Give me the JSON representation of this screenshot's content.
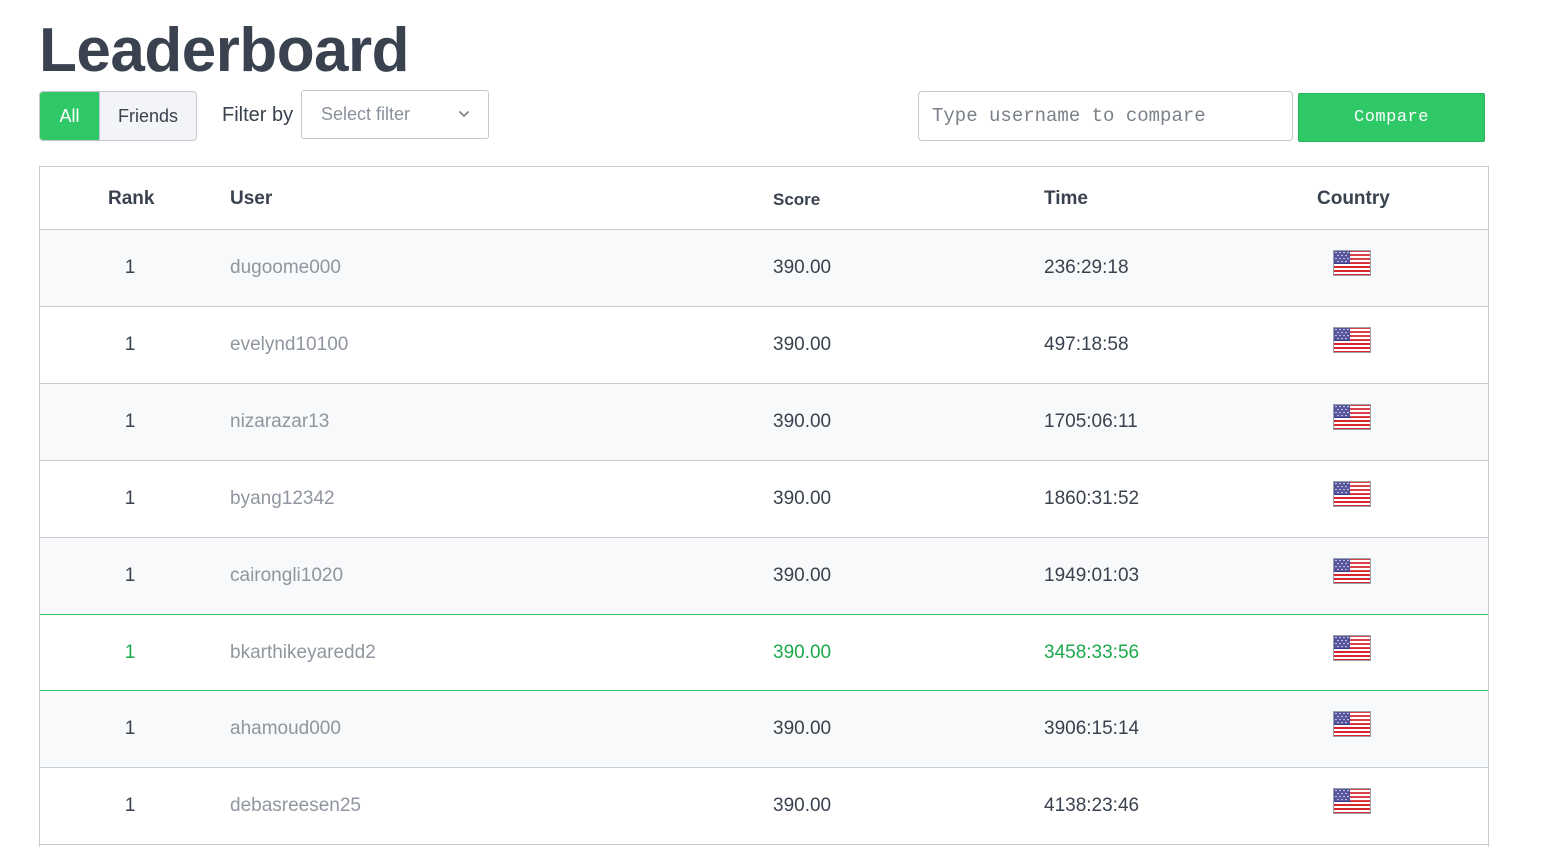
{
  "page": {
    "title": "Leaderboard"
  },
  "toggle": {
    "all": "All",
    "friends": "Friends",
    "active": "All"
  },
  "filter": {
    "label": "Filter by",
    "placeholder": "Select filter"
  },
  "compare": {
    "placeholder": "Type username to compare",
    "button": "Compare"
  },
  "table": {
    "headers": {
      "rank": "Rank",
      "user": "User",
      "score": "Score",
      "time": "Time",
      "country": "Country"
    },
    "rows": [
      {
        "rank": "1",
        "user": "dugoome000",
        "score": "390.00",
        "time": "236:29:18",
        "country_icon": "us-flag-icon"
      },
      {
        "rank": "1",
        "user": "evelynd10100",
        "score": "390.00",
        "time": "497:18:58",
        "country_icon": "us-flag-icon"
      },
      {
        "rank": "1",
        "user": "nizarazar13",
        "score": "390.00",
        "time": "1705:06:11",
        "country_icon": "us-flag-icon"
      },
      {
        "rank": "1",
        "user": "byang12342",
        "score": "390.00",
        "time": "1860:31:52",
        "country_icon": "us-flag-icon"
      },
      {
        "rank": "1",
        "user": "cairongli1020",
        "score": "390.00",
        "time": "1949:01:03",
        "country_icon": "us-flag-icon"
      },
      {
        "rank": "1",
        "user": "bkarthikeyaredd2",
        "score": "390.00",
        "time": "3458:33:56",
        "country_icon": "us-flag-icon",
        "highlighted": true
      },
      {
        "rank": "1",
        "user": "ahamoud000",
        "score": "390.00",
        "time": "3906:15:14",
        "country_icon": "us-flag-icon"
      },
      {
        "rank": "1",
        "user": "debasreesen25",
        "score": "390.00",
        "time": "4138:23:46",
        "country_icon": "us-flag-icon"
      }
    ]
  },
  "colors": {
    "accent": "#2ec866",
    "highlight_text": "#1ba94c",
    "text": "#39424e",
    "username": "#8f969f"
  }
}
